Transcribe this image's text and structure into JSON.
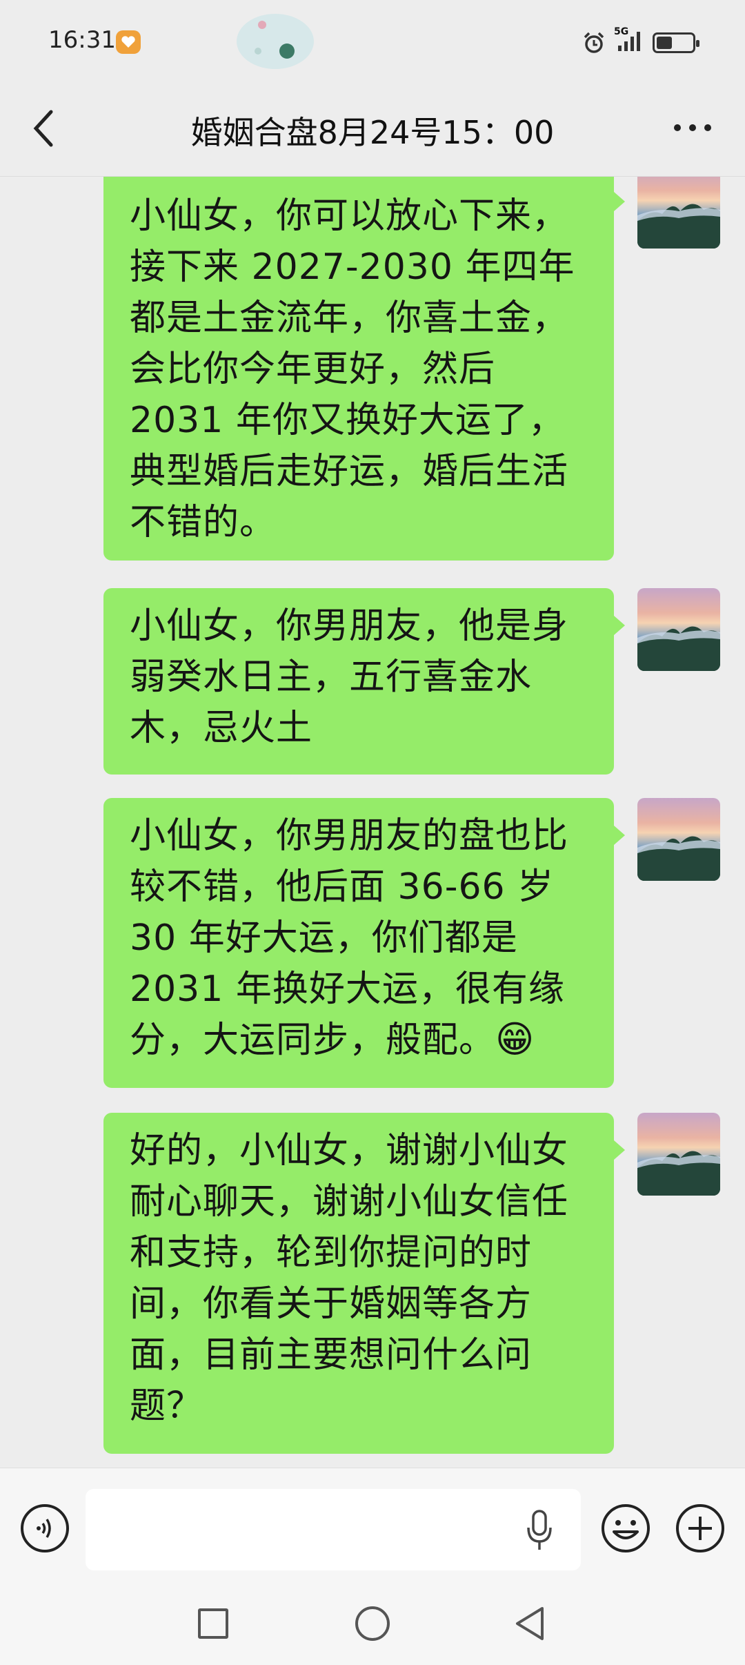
{
  "status_bar": {
    "time": "16:31",
    "network": "5G",
    "icons": [
      "notification-app-icon",
      "alarm-icon",
      "signal-icon",
      "battery-icon"
    ]
  },
  "header": {
    "title": "婚姻合盘8月24号15：00",
    "back_icon": "chevron-left-icon",
    "more_icon": "more-dots-icon"
  },
  "messages": [
    {
      "sender": "self",
      "text": "小仙女，你可以放心下来，接下来 2027-2030 年四年都是土金流年，你喜土金，会比你今年更好，然后 2031 年你又换好大运了，典型婚后走好运，婚后生活不错的。"
    },
    {
      "sender": "self",
      "text": "小仙女，你男朋友，他是身弱癸水日主，五行喜金水木，忌火土"
    },
    {
      "sender": "self",
      "text": "小仙女，你男朋友的盘也比较不错，他后面 36-66 岁 30 年好大运，你们都是 2031 年换好大运，很有缘分，大运同步，般配。",
      "emoji": "😁"
    },
    {
      "sender": "self",
      "text": "好的，小仙女，谢谢小仙女耐心聊天，谢谢小仙女信任和支持，轮到你提问的时间，你看关于婚姻等各方面，目前主要想问什么问题？"
    }
  ],
  "input_bar": {
    "text_value": "",
    "icons": [
      "voice-icon",
      "mic-icon",
      "emoji-icon",
      "plus-icon"
    ]
  },
  "nav_bar": {
    "icons": [
      "recents-icon",
      "home-icon",
      "back-icon"
    ]
  },
  "colors": {
    "bubble": "#95ec69",
    "background": "#ededed",
    "bar": "#f6f6f6"
  }
}
